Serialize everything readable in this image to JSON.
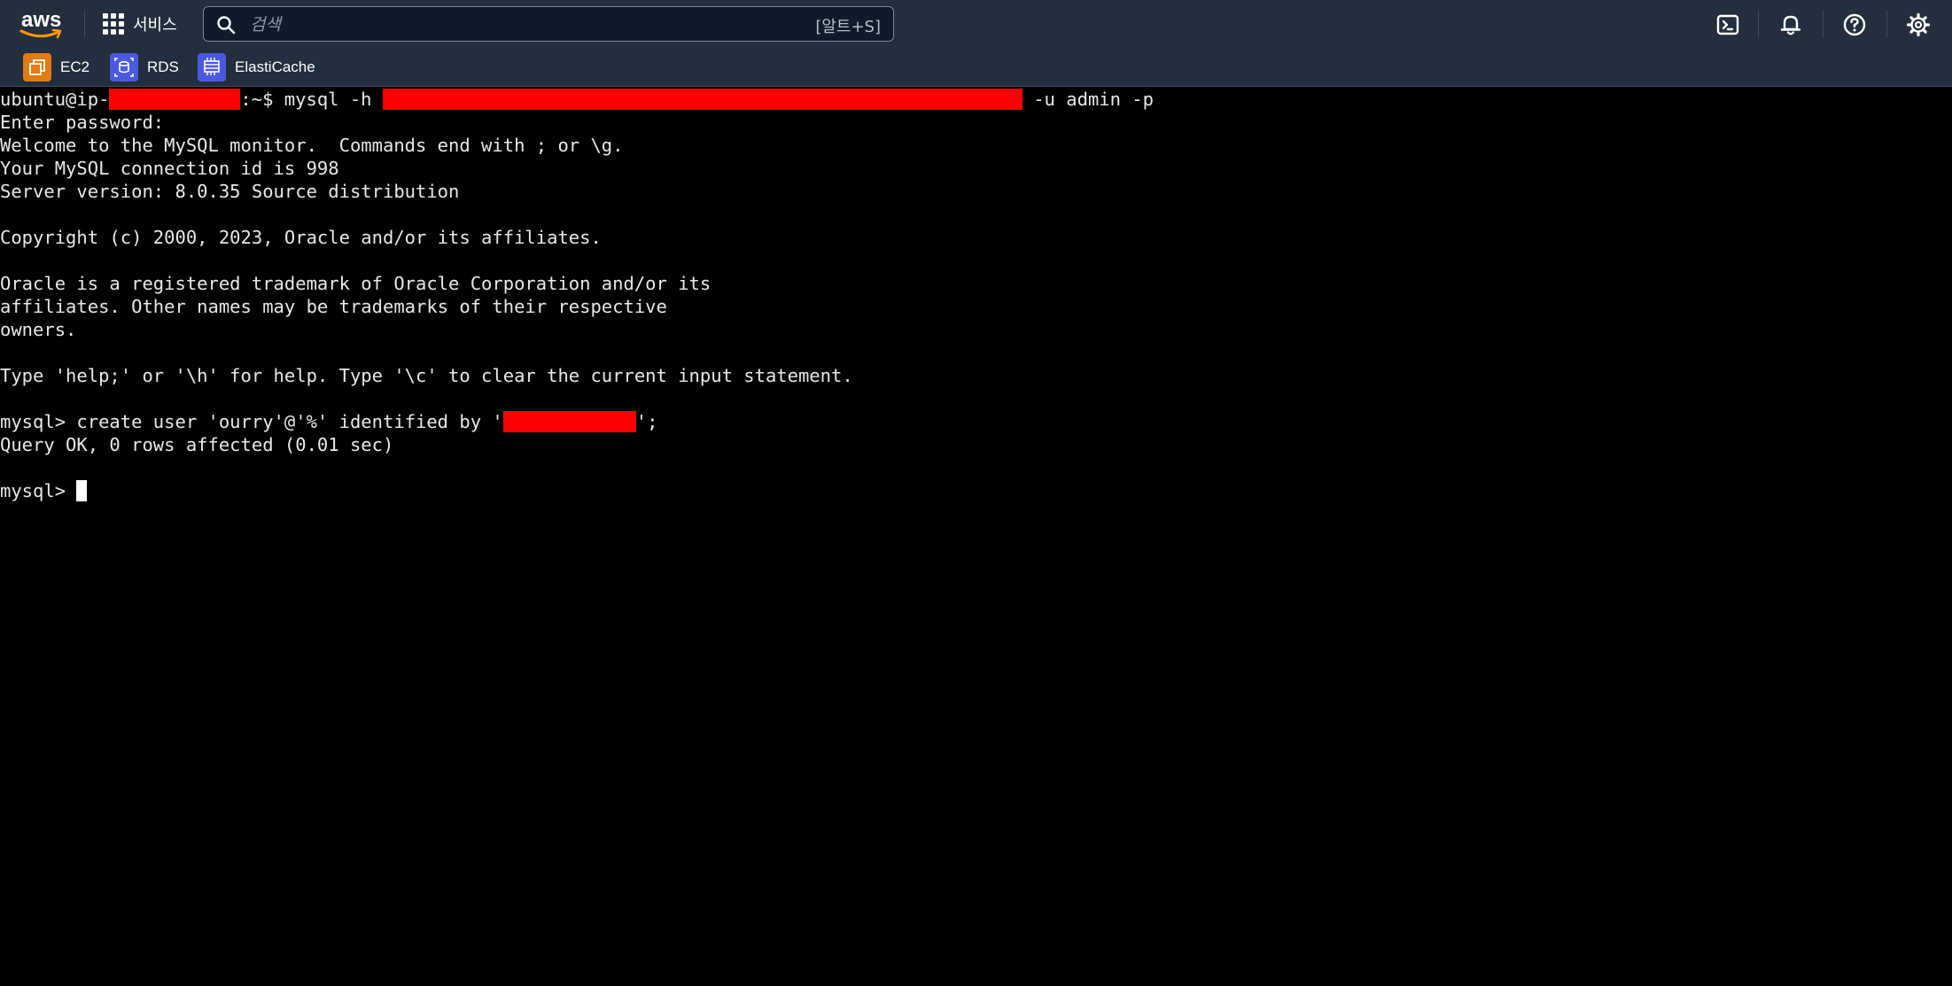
{
  "nav": {
    "logo_text": "aws",
    "services_label": "서비스",
    "search": {
      "placeholder": "검색",
      "value": "",
      "shortcut": "[알트+S]"
    },
    "icons": [
      "cloudshell-icon",
      "notifications-bell-icon",
      "help-icon",
      "settings-gear-icon"
    ]
  },
  "favorites": [
    {
      "label": "EC2",
      "icon": "ec2-icon",
      "color": "#e07b16"
    },
    {
      "label": "RDS",
      "icon": "rds-icon",
      "color": "#4a5ae0"
    },
    {
      "label": "ElastiCache",
      "icon": "elasticache-icon",
      "color": "#4a5ae0"
    }
  ],
  "terminal": {
    "prompt_host_prefix": "ubuntu@ip-",
    "prompt_cmd_mid": ":~$ mysql -h ",
    "prompt_cmd_end": " -u admin -p",
    "lines": [
      "Enter password:",
      "Welcome to the MySQL monitor.  Commands end with ; or \\g.",
      "Your MySQL connection id is 998",
      "Server version: 8.0.35 Source distribution",
      "",
      "Copyright (c) 2000, 2023, Oracle and/or its affiliates.",
      "",
      "Oracle is a registered trademark of Oracle Corporation and/or its",
      "affiliates. Other names may be trademarks of their respective",
      "owners.",
      "",
      "Type 'help;' or '\\h' for help. Type '\\c' to clear the current input statement.",
      ""
    ],
    "create_user_prefix": "mysql> create user 'ourry'@'%' identified by '",
    "create_user_suffix": "';",
    "query_result": "Query OK, 0 rows affected (0.01 sec)",
    "final_prompt": "mysql> ",
    "redaction_color": "#ff0000",
    "text_color": "#e8e8e8",
    "background": "#000000"
  }
}
